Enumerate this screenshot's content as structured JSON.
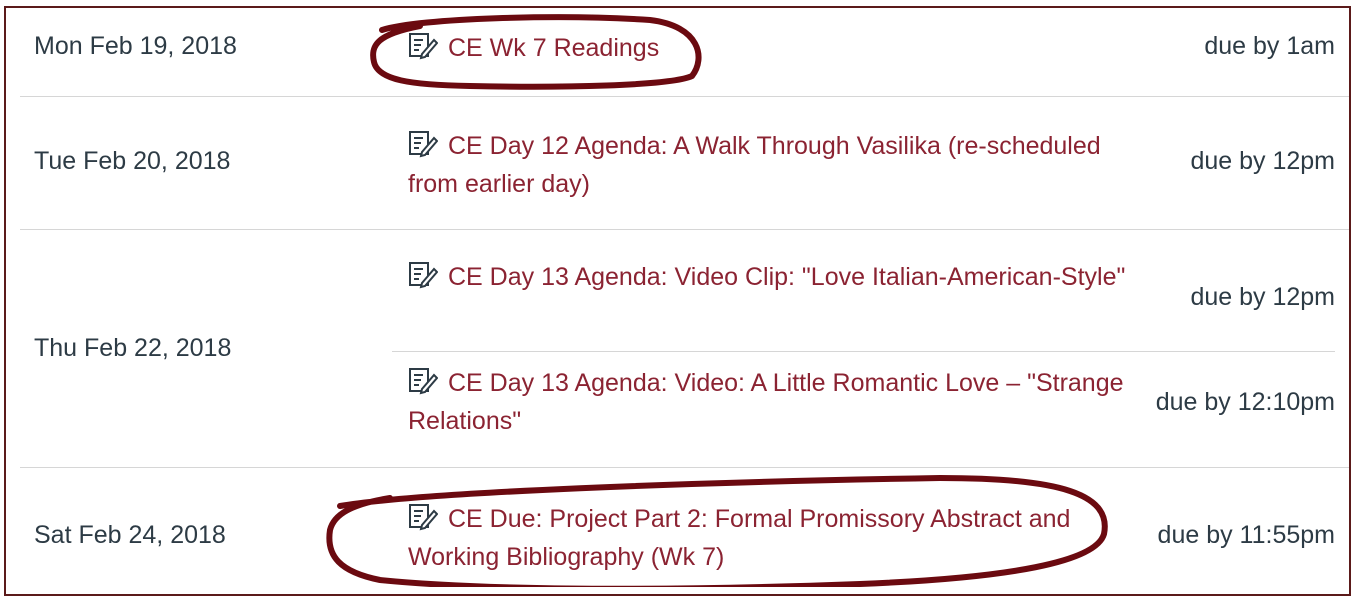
{
  "rows": [
    {
      "date": "Mon Feb 19, 2018",
      "items": [
        {
          "icon": "assignment-icon",
          "title": "CE Wk 7 Readings",
          "due": "due by 1am"
        }
      ]
    },
    {
      "date": "Tue Feb 20, 2018",
      "items": [
        {
          "icon": "assignment-icon",
          "title": "CE Day 12 Agenda: A Walk Through Vasilika (re-scheduled from earlier day)",
          "due": "due by 12pm"
        }
      ]
    },
    {
      "date": "Thu Feb 22, 2018",
      "items": [
        {
          "icon": "assignment-icon",
          "title": "CE Day 13 Agenda: Video Clip: \"Love Italian-American-Style\"",
          "due": "due by 12pm"
        },
        {
          "icon": "assignment-icon",
          "title": "CE Day 13 Agenda: Video: A Little Romantic Love – \"Strange Relations\"",
          "due": "due by 12:10pm"
        }
      ]
    },
    {
      "date": "Sat Feb 24, 2018",
      "items": [
        {
          "icon": "assignment-icon",
          "title": "CE Due: Project Part 2: Formal Promissory Abstract and Working Bibliography (Wk 7)",
          "due": "due by 11:55pm"
        }
      ]
    }
  ],
  "colors": {
    "link": "#8b2332",
    "text": "#2d3b45",
    "divider": "#d6d6d6",
    "frame": "#5b1a1a",
    "annotation": "#6b0a10"
  }
}
